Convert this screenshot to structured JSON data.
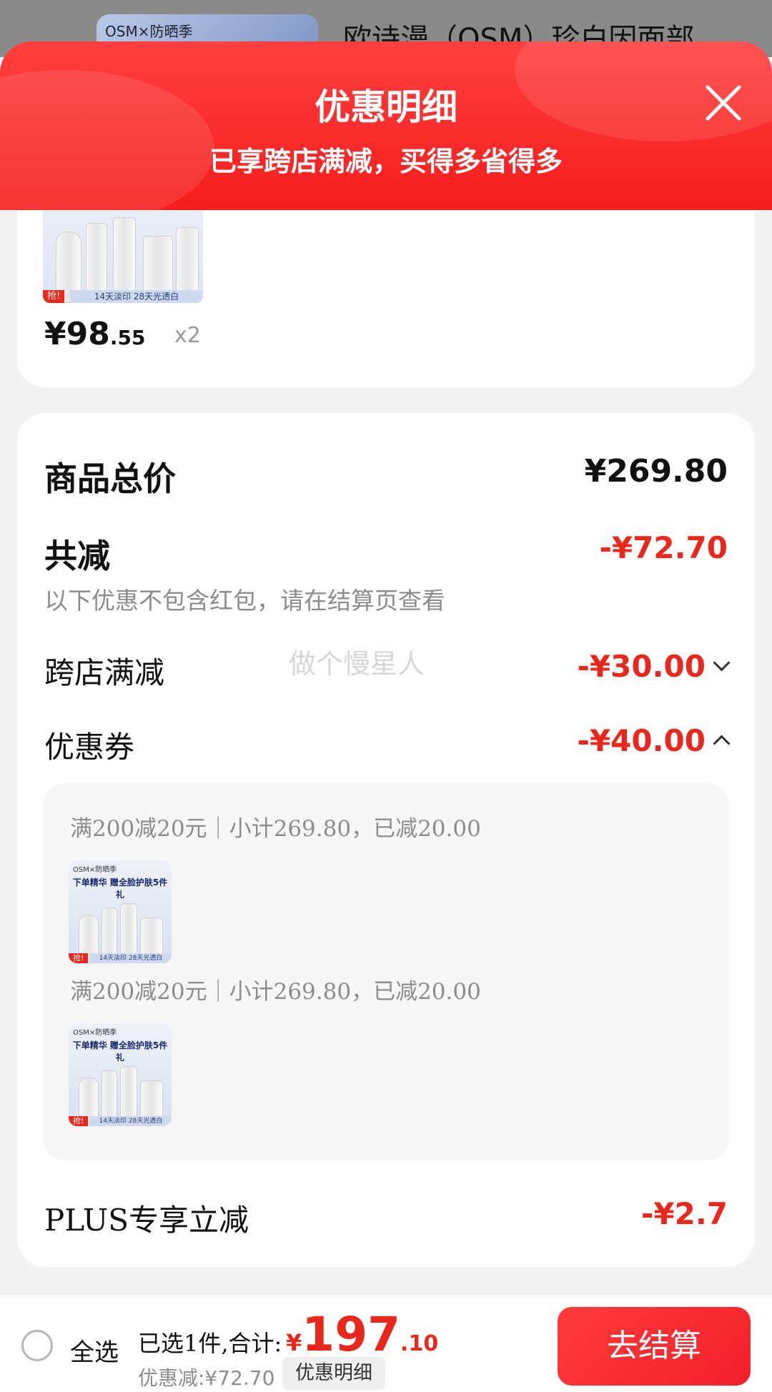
{
  "background": {
    "product_title": "欧诗漫（OSM）珍白因面部",
    "thumb_brand": "OSM×防晒季"
  },
  "header": {
    "title": "优惠明细",
    "subtitle": "已享跨店满减，买得多省得多"
  },
  "product": {
    "price_int": "¥98",
    "price_dec": ".55",
    "quantity": "x2",
    "image_tag_left": "抢!",
    "image_tag_right": "14天淡印 28天光透白"
  },
  "summary": {
    "total_label": "商品总价",
    "total_value": "¥269.80",
    "reduction_label": "共减",
    "reduction_value": "-¥72.70",
    "reduction_note": "以下优惠不包含红包，请在结算页查看",
    "watermark": "做个慢星人",
    "cross_store_label": "跨店满减",
    "cross_store_value": "-¥30.00",
    "coupon_label": "优惠券",
    "coupon_value": "-¥40.00",
    "coupon_details": [
      {
        "text": "满200减20元｜小计269.80，已减20.00"
      },
      {
        "text": "满200减20元｜小计269.80，已减20.00"
      }
    ],
    "thumb_title": "下单精华 赠全脸护肤5件礼",
    "plus_label": "PLUS专享立减",
    "plus_value": "-¥2.7"
  },
  "bottom_bar": {
    "select_all": "全选",
    "selected_count": "已选1件,合计:",
    "total_currency": "¥",
    "total_int": "197",
    "total_dec": ".10",
    "discount_text": "优惠减:¥72.70",
    "detail_button": "优惠明细",
    "checkout_button": "去结算"
  },
  "colors": {
    "accent_red": "#e8281c",
    "header_red": "#f51d1d"
  }
}
